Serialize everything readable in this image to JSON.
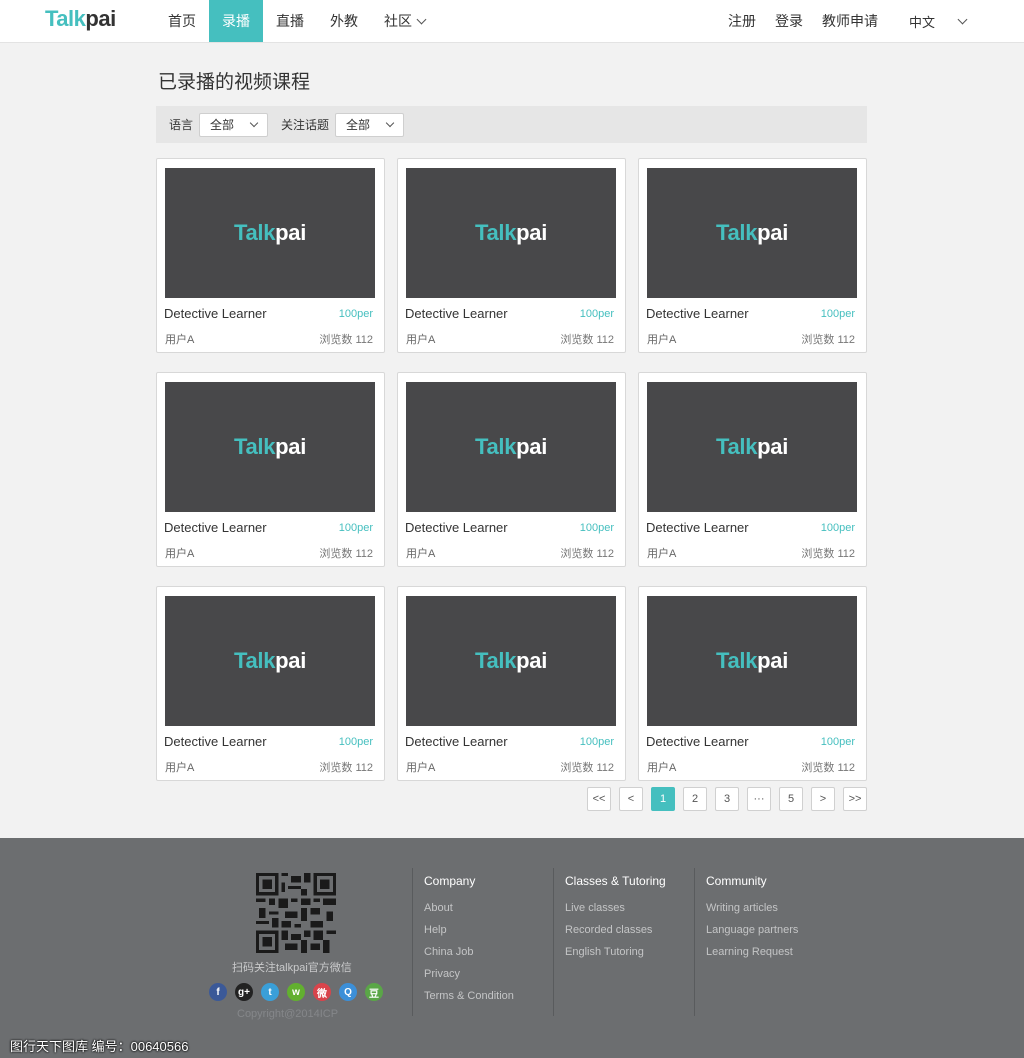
{
  "header": {
    "logo_part1": "Talk",
    "logo_part2": "pai",
    "nav": [
      {
        "label": "首页"
      },
      {
        "label": "录播"
      },
      {
        "label": "直播"
      },
      {
        "label": "外教"
      },
      {
        "label": "社区"
      }
    ],
    "register": "注册",
    "login": "登录",
    "teacher_apply": "教师申请",
    "language": "中文"
  },
  "page_title": "已录播的视频课程",
  "filters": {
    "language_label": "语言",
    "language_value": "全部",
    "topic_label": "关注话题",
    "topic_value": "全部"
  },
  "courses": [
    {
      "logo1": "Talk",
      "logo2": "pai",
      "title": "Detective Learner",
      "price": "100per",
      "user": "用户A",
      "views": "浏览数 112"
    },
    {
      "logo1": "Talk",
      "logo2": "pai",
      "title": "Detective Learner",
      "price": "100per",
      "user": "用户A",
      "views": "浏览数 112"
    },
    {
      "logo1": "Talk",
      "logo2": "pai",
      "title": "Detective Learner",
      "price": "100per",
      "user": "用户A",
      "views": "浏览数 112"
    },
    {
      "logo1": "Talk",
      "logo2": "pai",
      "title": "Detective Learner",
      "price": "100per",
      "user": "用户A",
      "views": "浏览数 112"
    },
    {
      "logo1": "Talk",
      "logo2": "pai",
      "title": "Detective Learner",
      "price": "100per",
      "user": "用户A",
      "views": "浏览数 112"
    },
    {
      "logo1": "Talk",
      "logo2": "pai",
      "title": "Detective Learner",
      "price": "100per",
      "user": "用户A",
      "views": "浏览数 112"
    },
    {
      "logo1": "Talk",
      "logo2": "pai",
      "title": "Detective Learner",
      "price": "100per",
      "user": "用户A",
      "views": "浏览数 112"
    },
    {
      "logo1": "Talk",
      "logo2": "pai",
      "title": "Detective Learner",
      "price": "100per",
      "user": "用户A",
      "views": "浏览数 112"
    },
    {
      "logo1": "Talk",
      "logo2": "pai",
      "title": "Detective Learner",
      "price": "100per",
      "user": "用户A",
      "views": "浏览数 112"
    }
  ],
  "pagination": {
    "first": "<<",
    "prev": "<",
    "p1": "1",
    "p2": "2",
    "p3": "3",
    "ellipsis": "···",
    "p5": "5",
    "next": ">",
    "last": ">>",
    "current": 1
  },
  "footer": {
    "qr_caption": "扫码关注talkpai官方微信",
    "copyright": "Copyright@2014ICP",
    "socials": [
      {
        "icon": "facebook-icon",
        "glyph": "f",
        "color": "#3b5998"
      },
      {
        "icon": "google-plus-icon",
        "glyph": "g+",
        "color": "#222222"
      },
      {
        "icon": "twitter-icon",
        "glyph": "t",
        "color": "#3a9fd8"
      },
      {
        "icon": "wechat-icon",
        "glyph": "w",
        "color": "#62b02f"
      },
      {
        "icon": "weibo-icon",
        "glyph": "微",
        "color": "#d9444b"
      },
      {
        "icon": "qq-icon",
        "glyph": "Q",
        "color": "#3c8fd8"
      },
      {
        "icon": "douban-icon",
        "glyph": "豆",
        "color": "#5aa647"
      }
    ],
    "columns": [
      {
        "title": "Company",
        "links": [
          "About",
          "Help",
          "China Job",
          "Privacy",
          "Terms & Condition"
        ]
      },
      {
        "title": "Classes & Tutoring",
        "links": [
          "Live classes",
          "Recorded classes",
          "English Tutoring"
        ]
      },
      {
        "title": "Community",
        "links": [
          "Writing articles",
          "Language partners",
          "Learning Request"
        ]
      }
    ]
  },
  "watermark": "图行天下图库     编号：00640566",
  "colors": {
    "accent": "#45bfbf",
    "thumb_bg": "#48484a",
    "footer_bg": "#6c6e70"
  }
}
